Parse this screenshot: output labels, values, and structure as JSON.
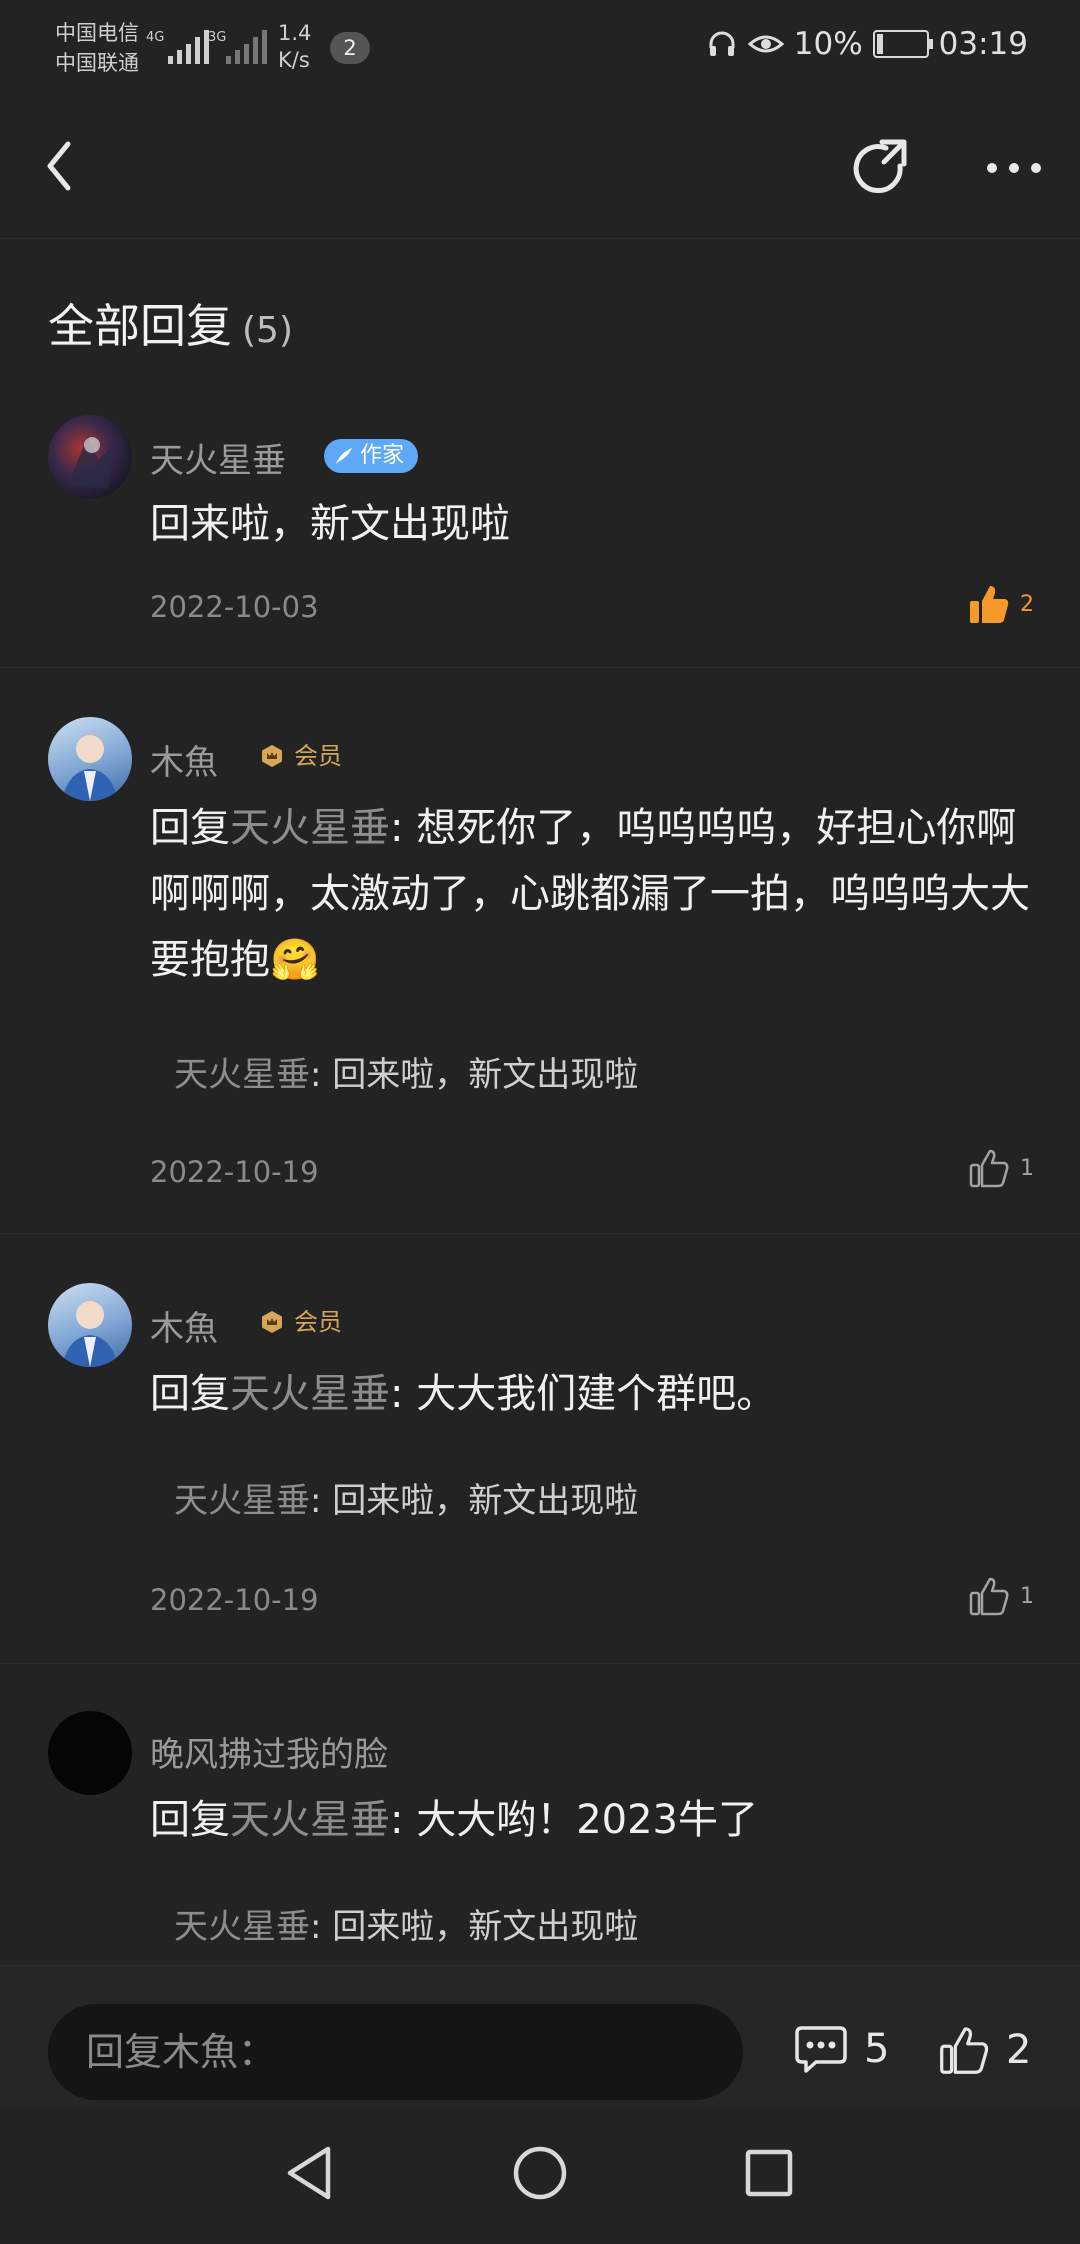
{
  "status_bar": {
    "carrier1": "中国电信",
    "carrier2": "中国联通",
    "net1": "4G",
    "net2": "3G",
    "speed_value": "1.4",
    "speed_unit": "K/s",
    "notification_count": "2",
    "battery": "10%",
    "time": "03:19"
  },
  "header": {
    "title": "全部回复",
    "count": "(5)"
  },
  "comments": [
    {
      "user": "天火星垂",
      "badge": "作家",
      "text": "回来啦，新文出现啦",
      "date": "2022-10-03",
      "likes": "2",
      "liked": true
    },
    {
      "user": "木魚",
      "badge": "会员",
      "reply_prefix": "回复",
      "reply_to": "天火星垂",
      "text": ": 想死你了，呜呜呜呜，好担心你啊啊啊啊，太激动了，心跳都漏了一拍，呜呜呜大大要抱抱🤗",
      "quote_user": "天火星垂",
      "quote_text": ": 回来啦，新文出现啦",
      "date": "2022-10-19",
      "likes": "1"
    },
    {
      "user": "木魚",
      "badge": "会员",
      "reply_prefix": "回复",
      "reply_to": "天火星垂",
      "text": ": 大大我们建个群吧。",
      "quote_user": "天火星垂",
      "quote_text": ": 回来啦，新文出现啦",
      "date": "2022-10-19",
      "likes": "1"
    },
    {
      "user": "晚风拂过我的脸",
      "reply_prefix": "回复",
      "reply_to": "天火星垂",
      "text": ": 大大哟！2023牛了",
      "quote_user": "天火星垂",
      "quote_text": ": 回来啦，新文出现啦"
    }
  ],
  "bottom_bar": {
    "reply_placeholder": "回复木魚：",
    "comment_count": "5",
    "like_count": "2"
  },
  "colors": {
    "background": "#232323",
    "accent_like": "#f39a2a",
    "writer_badge": "#5fa8f5",
    "vip_badge": "#d6a65a"
  }
}
